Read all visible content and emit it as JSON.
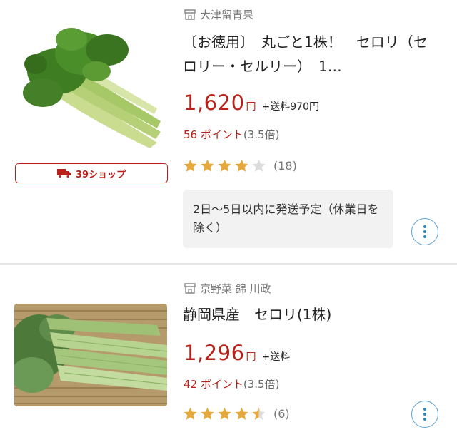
{
  "products": [
    {
      "shop_name": "大津留青果",
      "shop_icon": "shop-icon",
      "title": "〔お徳用〕　丸ごと1株！　セロリ（セロリー・セルリー）　1…",
      "price": "1,620",
      "currency": "円",
      "shipping": "+送料970円",
      "points": "56 ポイント",
      "points_ratio": "(3.5倍)",
      "rating": 4,
      "review_count": "(18)",
      "badge": "39ショップ",
      "delivery_note": "2日〜5日以内に発送予定（休業日を除く）",
      "thumbnail": "celery-bunch-photo"
    },
    {
      "shop_name": "京野菜 錦 川政",
      "shop_icon": "shop-icon",
      "title": "静岡県産　セロリ(1株)",
      "price": "1,296",
      "currency": "円",
      "shipping": "+送料",
      "points": "42 ポイント",
      "points_ratio": "(3.5倍)",
      "rating": 4.5,
      "review_count": "(6)",
      "thumbnail": "celery-stalks-photo"
    }
  ],
  "colors": {
    "price_red": "#b8221a",
    "star_gold": "#e8a93c",
    "star_empty": "#dcdcdc",
    "more_blue": "#2f86c7"
  },
  "icons": {
    "more": "more-vertical-icon",
    "truck": "delivery-truck-icon",
    "star": "star-icon"
  }
}
